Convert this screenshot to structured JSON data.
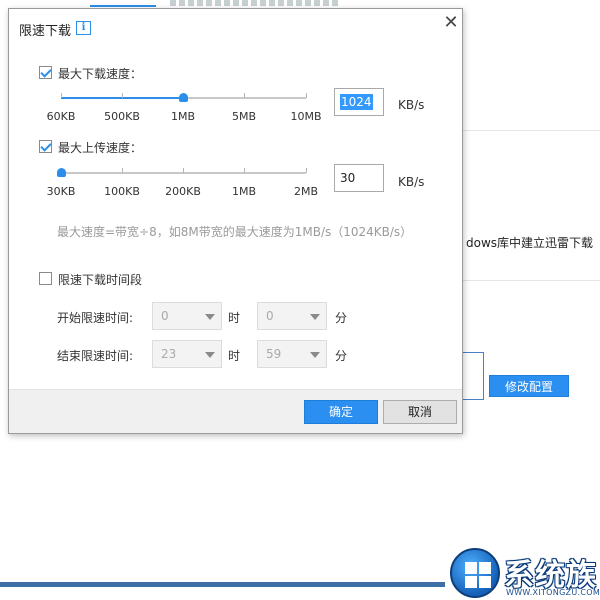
{
  "background": {
    "text_fragment": "dows库中建立迅雷下载（",
    "modify_button": "修改配置",
    "watermark": {
      "name": "系统族",
      "url": "WWW.XITONGZU.COM"
    }
  },
  "dialog": {
    "title": "限速下载",
    "info_icon": "i",
    "close_icon": "✕",
    "download": {
      "label": "最大下载速度：",
      "checked": true,
      "ticks": [
        "60KB",
        "500KB",
        "1MB",
        "5MB",
        "10MB"
      ],
      "slider_fraction": 0.5,
      "value": "1024",
      "unit": "KB/s"
    },
    "upload": {
      "label": "最大上传速度：",
      "checked": true,
      "ticks": [
        "30KB",
        "100KB",
        "200KB",
        "1MB",
        "2MB"
      ],
      "slider_fraction": 0.0,
      "value": "30",
      "unit": "KB/s"
    },
    "hint": "最大速度=带宽÷8，如8M带宽的最大速度为1MB/s（1024KB/s）",
    "schedule": {
      "label": "限速下载时间段",
      "checked": false,
      "start_label": "开始限速时间:",
      "start_hour": "0",
      "start_minute": "0",
      "end_label": "结束限速时间:",
      "end_hour": "23",
      "end_minute": "59",
      "hour_unit": "时",
      "minute_unit": "分"
    },
    "ok_button": "确定",
    "cancel_button": "取消"
  },
  "colors": {
    "accent": "#2b8ee8",
    "button_blue": "#2a8ff0"
  }
}
